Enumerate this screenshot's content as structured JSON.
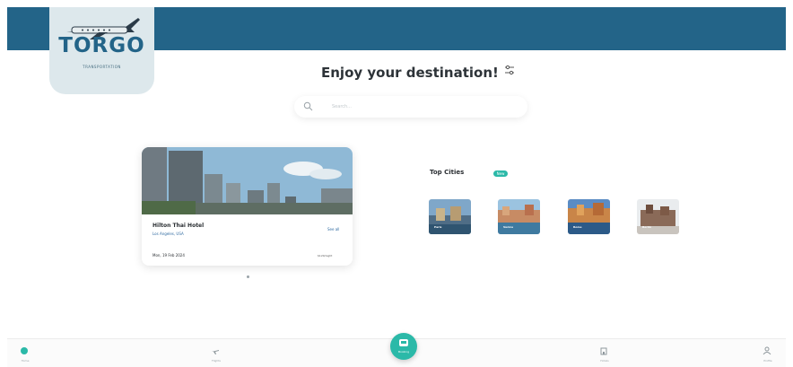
{
  "brand": {
    "logo_text": "TORGO",
    "logo_sub": "TRANSPORTATION"
  },
  "main": {
    "title": "Enjoy your destination!"
  },
  "search": {
    "placeholder": "Search..."
  },
  "hotel": {
    "name": "Hilton Thai Hotel",
    "location": "Los Angeles, USA",
    "link": "See all",
    "date": "Mon, 19 Feb 2024",
    "price": "$120/night"
  },
  "cities": {
    "title": "Top Cities",
    "badge": "New",
    "items": [
      {
        "label": "Paris"
      },
      {
        "label": "Venice"
      },
      {
        "label": "Rome"
      },
      {
        "label": "Berlin"
      }
    ]
  },
  "nav": {
    "items": [
      {
        "label": "Home"
      },
      {
        "label": "Flights"
      },
      {
        "label": "Hotels"
      },
      {
        "label": "Profile"
      }
    ],
    "center_label": "Booking"
  },
  "colors": {
    "header": "#236488",
    "accent": "#2bb9a8"
  }
}
